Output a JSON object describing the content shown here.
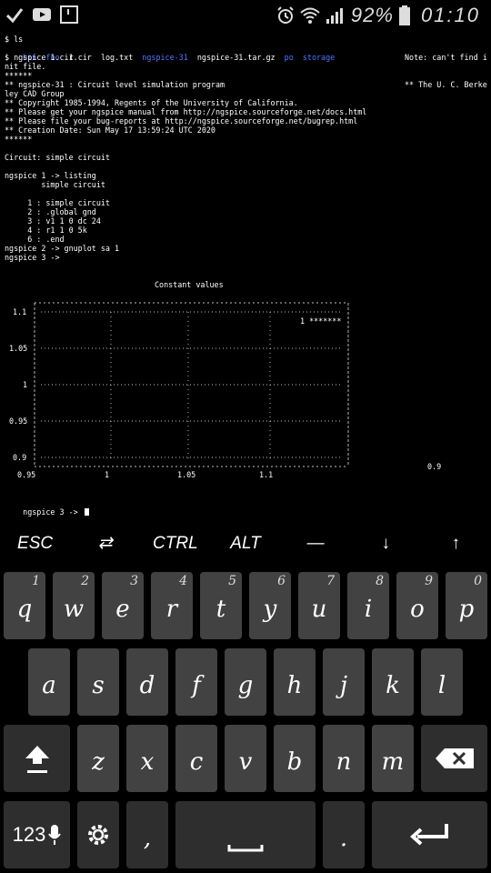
{
  "status_bar": {
    "battery_percent": "92%",
    "time": "01:10",
    "left_icons": [
      "check-icon",
      "youtube-icon",
      "notification-box-icon"
    ],
    "right_icons": [
      "alarm-icon",
      "wifi-icon",
      "signal-icon",
      "battery-icon"
    ]
  },
  "terminal": {
    "lines": [
      "$ ls",
      "",
      "$ ngspice 1.cir",
      "nit file.",
      "******",
      "** ngspice-31 : Circuit level simulation program",
      "ley CAD Group",
      "** Copyright 1985-1994, Regents of the University of California.",
      "** Please get your ngspice manual from http://ngspice.sourceforge.net/docs.html",
      "** Please file your bug-reports at http://ngspice.sourceforge.net/bugrep.html",
      "** Creation Date: Sun May 17 13:59:24 UTC 2020",
      "******",
      "",
      "Circuit: simple circuit",
      "",
      "ngspice 1 -> listing",
      "        simple circuit",
      "",
      "     1 : simple circuit",
      "     2 : .global gnd",
      "     3 : v1 1 0 dc 24",
      "     4 : r1 1 0 5k",
      "     6 : .end",
      "ngspice 2 -> gnuplot sa 1",
      "ngspice 3 ->"
    ],
    "ls_items": [
      {
        "name": "bin",
        "color": "blue"
      },
      {
        "name": "foo",
        "color": "blue"
      },
      {
        "name": "1.cir",
        "color": "white"
      },
      {
        "name": "log.txt",
        "color": "white"
      },
      {
        "name": "ngspice-31",
        "color": "blue"
      },
      {
        "name": "ngspice-31.tar.gz",
        "color": "white"
      },
      {
        "name": "po",
        "color": "blue"
      },
      {
        "name": "storage",
        "color": "blue"
      }
    ],
    "right_notes": [
      "Note: can't find i",
      "** The U. C. Berke"
    ],
    "plot": {
      "title": "Constant values",
      "y_ticks": [
        "1.1",
        "1.05",
        "1",
        "0.95",
        "0.9"
      ],
      "x_ticks": [
        "0.95",
        "1",
        "1.05",
        "1.1"
      ],
      "legend": "1 *******",
      "extra_label": "0.9"
    },
    "prompt": "ngspice 3 ->"
  },
  "extra_keys": [
    "ESC",
    "⇄",
    "CTRL",
    "ALT",
    "—",
    "↓",
    "↑"
  ],
  "keyboard": {
    "row1": [
      {
        "key": "q",
        "hint": "1"
      },
      {
        "key": "w",
        "hint": "2"
      },
      {
        "key": "e",
        "hint": "3"
      },
      {
        "key": "r",
        "hint": "4"
      },
      {
        "key": "t",
        "hint": "5"
      },
      {
        "key": "y",
        "hint": "6"
      },
      {
        "key": "u",
        "hint": "7"
      },
      {
        "key": "i",
        "hint": "8"
      },
      {
        "key": "o",
        "hint": "9"
      },
      {
        "key": "p",
        "hint": "0"
      }
    ],
    "row2": [
      "a",
      "s",
      "d",
      "f",
      "g",
      "h",
      "j",
      "k",
      "l"
    ],
    "row3": [
      "z",
      "x",
      "c",
      "v",
      "b",
      "n",
      "m"
    ],
    "numbers_key": "123",
    "comma": ",",
    "period": "."
  }
}
